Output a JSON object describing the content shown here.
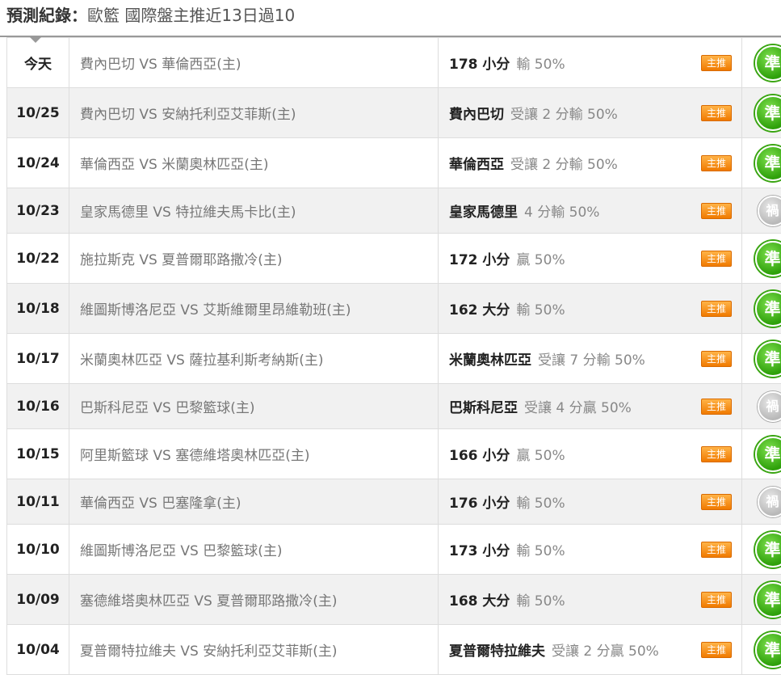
{
  "header": {
    "title_prefix": "預測紀錄：",
    "title_rest": "歐籃 國際盤主推近13日過10"
  },
  "colors": {
    "accent": "#f07a00",
    "win": "#2ea00a",
    "draw": "#b8b8b8"
  },
  "rows": [
    {
      "date": "今天",
      "home": "費內巴切",
      "vs": "VS",
      "away": "華倫西亞(主)",
      "pick_main": "178 小分",
      "pick_detail": "輸 50%",
      "tag": "主推",
      "result": "準",
      "result_type": "win"
    },
    {
      "date": "10/25",
      "home": "費內巴切",
      "vs": "VS",
      "away": "安納托利亞艾菲斯(主)",
      "pick_main": "費內巴切",
      "pick_detail": "受讓 2 分輸 50%",
      "tag": "主推",
      "result": "準",
      "result_type": "win"
    },
    {
      "date": "10/24",
      "home": "華倫西亞",
      "vs": "VS",
      "away": "米蘭奧林匹亞(主)",
      "pick_main": "華倫西亞",
      "pick_detail": "受讓 2 分輸 50%",
      "tag": "主推",
      "result": "準",
      "result_type": "win"
    },
    {
      "date": "10/23",
      "home": "皇家馬德里",
      "vs": "VS",
      "away": "特拉維夫馬卡比(主)",
      "pick_main": "皇家馬德里",
      "pick_detail": "4 分輸 50%",
      "tag": "主推",
      "result": "禍",
      "result_type": "draw"
    },
    {
      "date": "10/22",
      "home": "施拉斯克",
      "vs": "VS",
      "away": "夏普爾耶路撒冷(主)",
      "pick_main": "172 小分",
      "pick_detail": "贏 50%",
      "tag": "主推",
      "result": "準",
      "result_type": "win"
    },
    {
      "date": "10/18",
      "home": "維圖斯博洛尼亞",
      "vs": "VS",
      "away": "艾斯維爾里昂維勒班(主)",
      "pick_main": "162 大分",
      "pick_detail": "輸 50%",
      "tag": "主推",
      "result": "準",
      "result_type": "win"
    },
    {
      "date": "10/17",
      "home": "米蘭奧林匹亞",
      "vs": "VS",
      "away": "薩拉基利斯考納斯(主)",
      "pick_main": "米蘭奧林匹亞",
      "pick_detail": "受讓 7 分輸 50%",
      "tag": "主推",
      "result": "準",
      "result_type": "win"
    },
    {
      "date": "10/16",
      "home": "巴斯科尼亞",
      "vs": "VS",
      "away": "巴黎籃球(主)",
      "pick_main": "巴斯科尼亞",
      "pick_detail": "受讓 4 分贏 50%",
      "tag": "主推",
      "result": "禍",
      "result_type": "draw"
    },
    {
      "date": "10/15",
      "home": "阿里斯籃球",
      "vs": "VS",
      "away": "塞德維塔奧林匹亞(主)",
      "pick_main": "166 小分",
      "pick_detail": "贏 50%",
      "tag": "主推",
      "result": "準",
      "result_type": "win"
    },
    {
      "date": "10/11",
      "home": "華倫西亞",
      "vs": "VS",
      "away": "巴塞隆拿(主)",
      "pick_main": "176 小分",
      "pick_detail": "輸 50%",
      "tag": "主推",
      "result": "禍",
      "result_type": "draw"
    },
    {
      "date": "10/10",
      "home": "維圖斯博洛尼亞",
      "vs": "VS",
      "away": "巴黎籃球(主)",
      "pick_main": "173 小分",
      "pick_detail": "輸 50%",
      "tag": "主推",
      "result": "準",
      "result_type": "win"
    },
    {
      "date": "10/09",
      "home": "塞德維塔奧林匹亞",
      "vs": "VS",
      "away": "夏普爾耶路撒冷(主)",
      "pick_main": "168 大分",
      "pick_detail": "輸 50%",
      "tag": "主推",
      "result": "準",
      "result_type": "win"
    },
    {
      "date": "10/04",
      "home": "夏普爾特拉維夫",
      "vs": "VS",
      "away": "安納托利亞艾菲斯(主)",
      "pick_main": "夏普爾特拉維夫",
      "pick_detail": "受讓 2 分贏 50%",
      "tag": "主推",
      "result": "準",
      "result_type": "win"
    }
  ]
}
